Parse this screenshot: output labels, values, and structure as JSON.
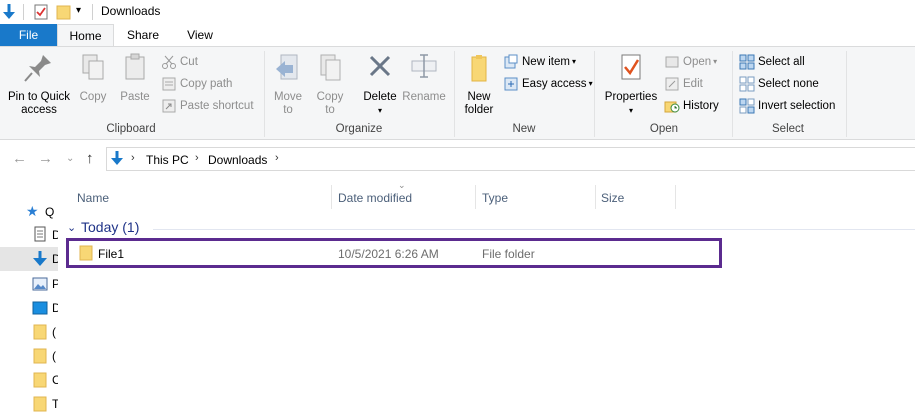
{
  "window": {
    "title": "Downloads"
  },
  "icons": {
    "qat_down_arrow": "down-arrow-icon",
    "qat_properties": "properties-check-icon",
    "qat_new_folder": "folder-icon",
    "qat_dropdown": "chevron-down-icon"
  },
  "tabs": [
    {
      "label": "File"
    },
    {
      "label": "Home"
    },
    {
      "label": "Share"
    },
    {
      "label": "View"
    }
  ],
  "ribbon": {
    "clipboard": {
      "label": "Clipboard",
      "pin": "Pin to Quick\naccess",
      "copy": "Copy",
      "paste": "Paste",
      "cut": "Cut",
      "copy_path": "Copy path",
      "paste_shortcut": "Paste shortcut"
    },
    "organize": {
      "label": "Organize",
      "move_to": "Move\nto",
      "copy_to": "Copy\nto",
      "delete": "Delete",
      "rename": "Rename"
    },
    "new": {
      "label": "New",
      "new_folder": "New\nfolder",
      "new_item": "New item",
      "easy_access": "Easy access"
    },
    "open": {
      "label": "Open",
      "properties": "Properties",
      "open": "Open",
      "edit": "Edit",
      "history": "History"
    },
    "select": {
      "label": "Select",
      "select_all": "Select all",
      "select_none": "Select none",
      "invert": "Invert selection"
    }
  },
  "address": {
    "crumbs": [
      "This PC",
      "Downloads"
    ]
  },
  "navpane": {
    "items": [
      {
        "text": "Q"
      },
      {
        "text": "D"
      },
      {
        "text": "D"
      },
      {
        "text": "P"
      },
      {
        "text": "D"
      },
      {
        "text": "("
      },
      {
        "text": "("
      },
      {
        "text": "C"
      },
      {
        "text": "T"
      }
    ]
  },
  "columns": [
    "Name",
    "Date modified",
    "Type",
    "Size"
  ],
  "group": {
    "label": "Today (1)"
  },
  "files": [
    {
      "name": "File1",
      "date": "10/5/2021 6:26 AM",
      "type": "File folder",
      "size": ""
    }
  ],
  "colors": {
    "file_tab": "#1979ca",
    "selection_border": "#5b2b8f",
    "group_header": "#1e3287",
    "folder": "#f8d775"
  }
}
